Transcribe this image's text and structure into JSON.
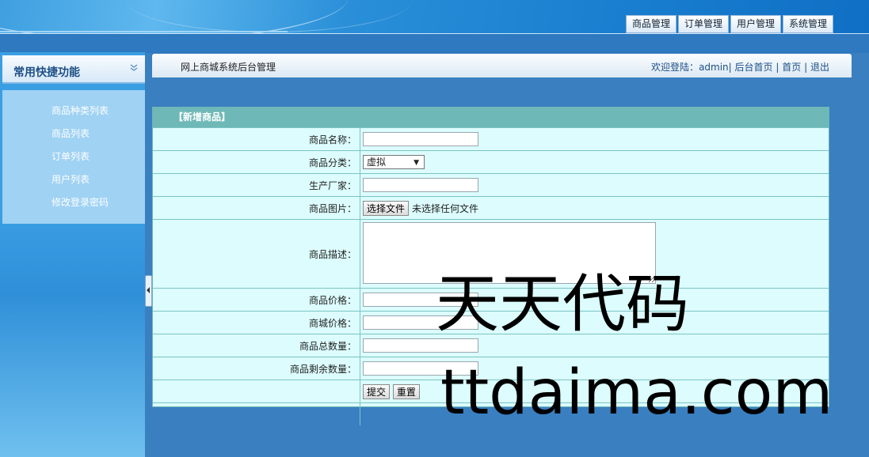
{
  "top_nav": {
    "tabs": [
      "商品管理",
      "订单管理",
      "用户管理",
      "系统管理"
    ]
  },
  "sidebar": {
    "title": "常用快捷功能",
    "collapse_icon": "double-chevron-down-icon",
    "items": [
      "商品种类列表",
      "商品列表",
      "订单列表",
      "用户列表",
      "修改登录密码"
    ]
  },
  "content_header": {
    "title": "网上商城系统后台管理",
    "welcome_prefix": "欢迎登陆：",
    "username": "admin",
    "sep": "|",
    "links": [
      "后台首页",
      "首页",
      "退出"
    ]
  },
  "form": {
    "caption": "【新增商品】",
    "labels": {
      "name": "商品名称：",
      "category": "商品分类：",
      "manufacturer": "生产厂家：",
      "image": "商品图片：",
      "description": "商品描述：",
      "price": "商品价格：",
      "mall_price": "商城价格：",
      "total": "商品总数量：",
      "remaining": "商品剩余数量："
    },
    "values": {
      "name": "",
      "category": "虚拟",
      "manufacturer": "",
      "description": "",
      "price": "",
      "mall_price": "",
      "total": "",
      "remaining": ""
    },
    "file_button": "选择文件",
    "file_hint": "未选择任何文件",
    "submit": "提交",
    "reset": "重置"
  },
  "watermark": {
    "line1": "天天代码",
    "line2": "ttdaima.com"
  },
  "colors": {
    "page_bg": "#3a7fc0",
    "caption_bg": "#6fb8b8",
    "form_bg": "#dcfcfd",
    "menu_bg": "#9fd2f3"
  }
}
